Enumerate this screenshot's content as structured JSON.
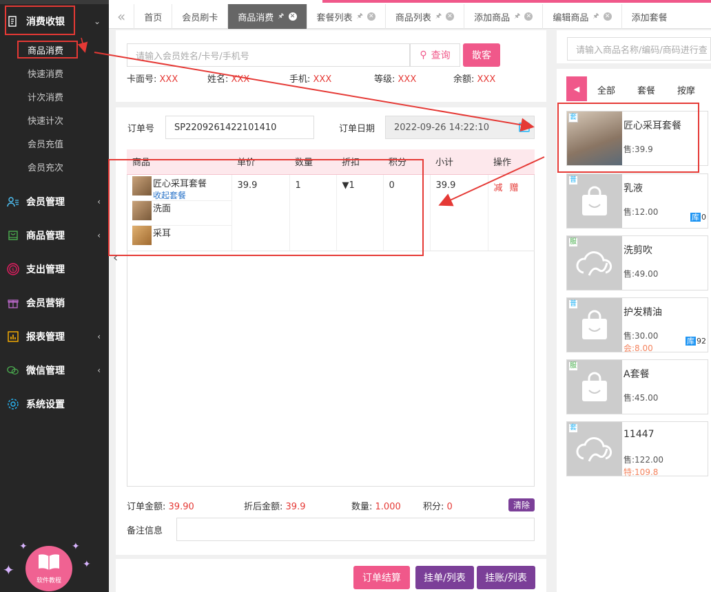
{
  "sidebar": {
    "menus": [
      {
        "label": "消费收银",
        "icon": "receipt-icon",
        "caret": "⌄"
      },
      {
        "label": "会员管理",
        "icon": "user-list-icon",
        "caret": "‹"
      },
      {
        "label": "商品管理",
        "icon": "shopping-bag-icon",
        "caret": "‹"
      },
      {
        "label": "支出管理",
        "icon": "coin-icon",
        "caret": ""
      },
      {
        "label": "会员营销",
        "icon": "gift-icon",
        "caret": ""
      },
      {
        "label": "报表管理",
        "icon": "bar-chart-icon",
        "caret": "‹"
      },
      {
        "label": "微信管理",
        "icon": "wechat-icon",
        "caret": "‹"
      },
      {
        "label": "系统设置",
        "icon": "gear-icon",
        "caret": ""
      }
    ],
    "submenu": [
      "商品消费",
      "快速消费",
      "计次消费",
      "快速计次",
      "会员充值",
      "会员充次"
    ],
    "help_label": "软件教程"
  },
  "tabs": {
    "back": "«",
    "items": [
      "首页",
      "会员刷卡",
      "商品消费",
      "套餐列表",
      "商品列表",
      "添加商品",
      "编辑商品",
      "添加套餐"
    ],
    "active_index": 2
  },
  "member": {
    "search_placeholder": "请输入会员姓名/卡号/手机号",
    "search_button": "查询",
    "guest_button": "散客",
    "fields": [
      {
        "label": "卡面号:",
        "value": "XXX"
      },
      {
        "label": "姓名:",
        "value": "XXX"
      },
      {
        "label": "手机:",
        "value": "XXX"
      },
      {
        "label": "等级:",
        "value": "XXX"
      },
      {
        "label": "余额:",
        "value": "XXX"
      }
    ]
  },
  "order": {
    "no_label": "订单号",
    "no_value": "SP2209261422101410",
    "date_label": "订单日期",
    "date_value": "2022-09-26 14:22:10",
    "columns": [
      "商品",
      "单价",
      "数量",
      "折扣",
      "积分",
      "小计",
      "操作"
    ],
    "row": {
      "product": "匠心采耳套餐",
      "collapse_link": "收起套餐",
      "sub_items": [
        "洗面",
        "采耳"
      ],
      "price": "39.9",
      "qty": "1",
      "discount": "▼1",
      "points": "0",
      "subtotal": "39.9",
      "op_reduce": "减",
      "op_gift": "赠"
    }
  },
  "summary": {
    "total_label": "订单金额:",
    "total_value": "39.90",
    "disc_label": "折后金额:",
    "disc_value": "39.9",
    "qty_label": "数量:",
    "qty_value": "1.000",
    "points_label": "积分:",
    "points_value": "0",
    "clear_button": "清除",
    "note_label": "备注信息"
  },
  "footer": {
    "checkout": "订单结算",
    "hang_order": "挂单/列表",
    "hang_account": "挂账/列表"
  },
  "products": {
    "search_placeholder": "请输入商品名称/编码/商码进行查",
    "categories": [
      "全部",
      "套餐",
      "按摩"
    ],
    "cards": [
      {
        "tag": "套",
        "name": "匠心采耳套餐",
        "price": "售:39.9",
        "price2": "",
        "stock": "",
        "img": "photo"
      },
      {
        "tag": "普",
        "name": "乳液",
        "price": "售:12.00",
        "price2": "",
        "stock": "0",
        "img": "bag"
      },
      {
        "tag": "服",
        "name": "洗剪吹",
        "price": "售:49.00",
        "price2": "",
        "stock": "",
        "img": "cloud"
      },
      {
        "tag": "普",
        "name": "护发精油",
        "price": "售:30.00",
        "price2": "会:8.00",
        "stock": "92",
        "img": "bag"
      },
      {
        "tag": "服",
        "name": "A套餐",
        "price": "售:45.00",
        "price2": "",
        "stock": "",
        "img": "bag"
      },
      {
        "tag": "套",
        "name": "11447",
        "price": "售:122.00",
        "price2": "特:109.8",
        "stock": "",
        "img": "cloud"
      }
    ],
    "stock_label": "库"
  },
  "colors": {
    "accent": "#f0588a",
    "purple": "#7b3f98",
    "red": "#e53935",
    "sidebar": "#262626"
  }
}
